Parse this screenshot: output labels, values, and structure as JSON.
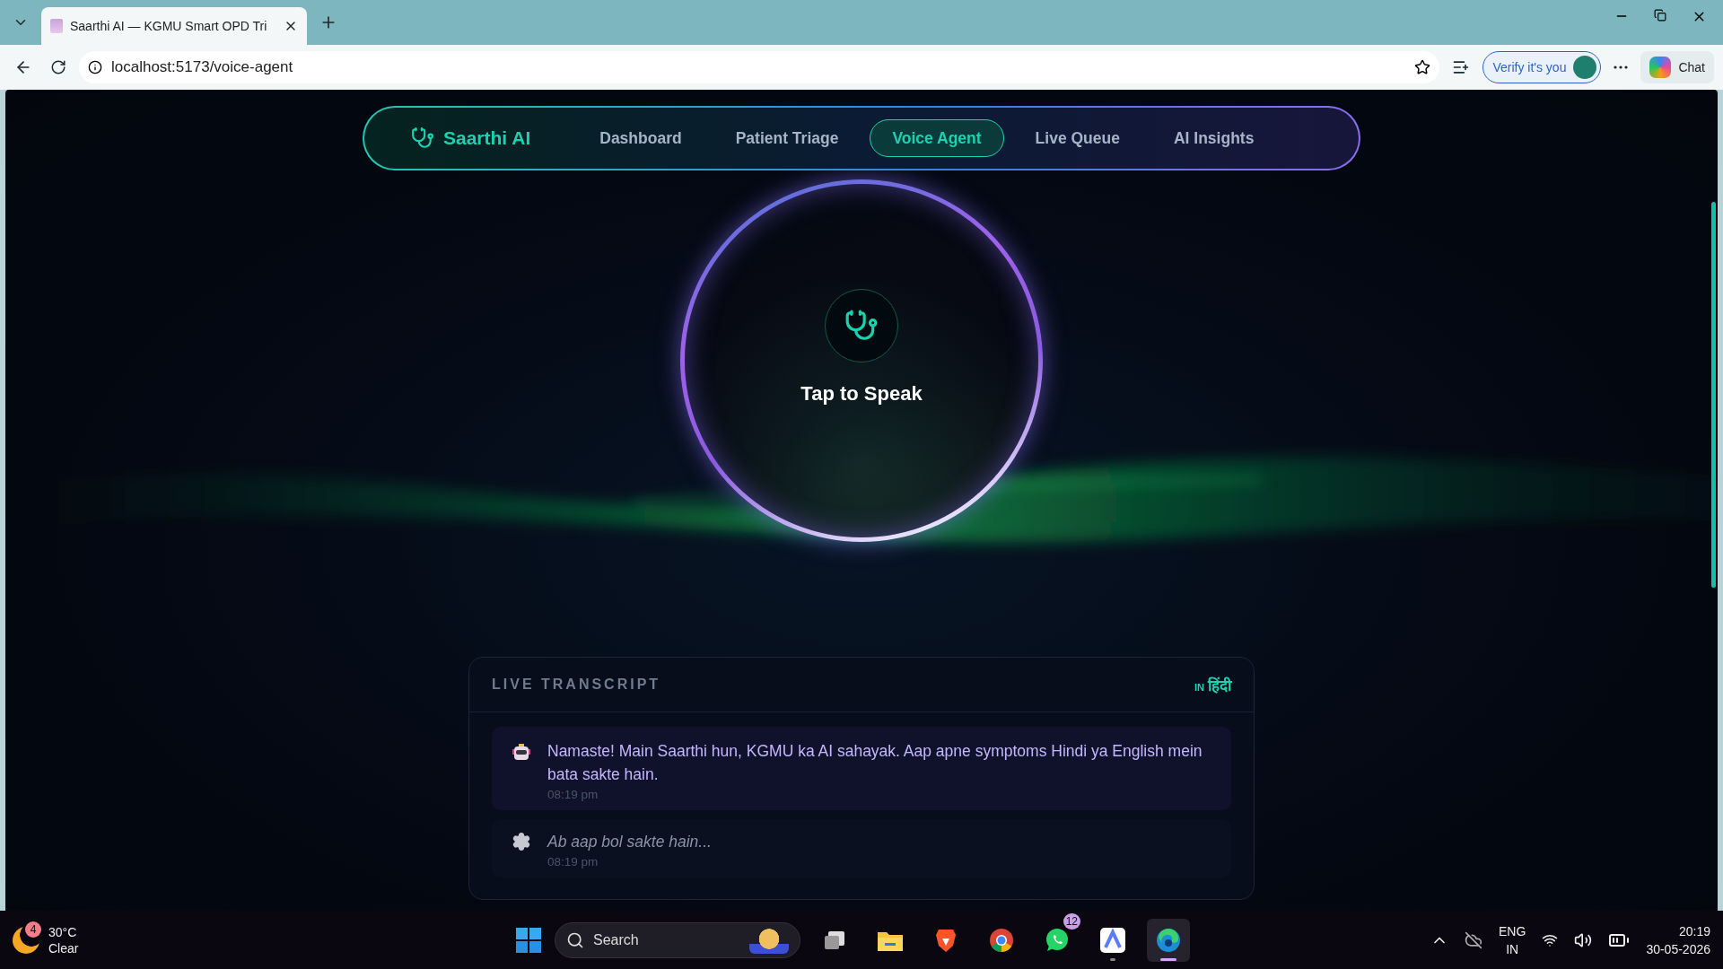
{
  "browser": {
    "tab_title": "Saarthi AI — KGMU Smart OPD Tri",
    "url": "localhost:5173/voice-agent",
    "profile_button": "Verify it's you",
    "chat_button": "Chat"
  },
  "nav": {
    "brand": "Saarthi AI",
    "items": [
      {
        "label": "Dashboard",
        "selected": false
      },
      {
        "label": "Patient Triage",
        "selected": false
      },
      {
        "label": "Voice Agent",
        "selected": true
      },
      {
        "label": "Live Queue",
        "selected": false
      },
      {
        "label": "AI Insights",
        "selected": false
      }
    ]
  },
  "voice": {
    "prompt": "Tap to Speak"
  },
  "transcript": {
    "title": "LIVE TRANSCRIPT",
    "language_flag": "IN",
    "language": "हिंदी",
    "messages": [
      {
        "kind": "assistant",
        "text": "Namaste! Main Saarthi hun, KGMU ka AI sahayak. Aap apne symptoms Hindi ya English mein bata sakte hain.",
        "time": "08:19 pm"
      },
      {
        "kind": "system",
        "text": "Ab aap bol sakte hain...",
        "time": "08:19 pm"
      }
    ]
  },
  "taskbar": {
    "weather_badge": "4",
    "temperature": "30°C",
    "condition": "Clear",
    "search_placeholder": "Search",
    "apps": [
      {
        "kind": "taskview",
        "selected": false,
        "running": false
      },
      {
        "kind": "folder",
        "selected": false,
        "running": false
      },
      {
        "kind": "brave",
        "selected": false,
        "running": false
      },
      {
        "kind": "chrome",
        "selected": false,
        "running": false
      },
      {
        "kind": "whatsapp",
        "selected": false,
        "running": false,
        "badge": "12"
      },
      {
        "kind": "arc",
        "selected": false,
        "running": true
      },
      {
        "kind": "edge",
        "selected": true,
        "running": true
      }
    ],
    "language": "ENG",
    "region": "IN",
    "time": "20:19",
    "date": "30-05-2026"
  }
}
